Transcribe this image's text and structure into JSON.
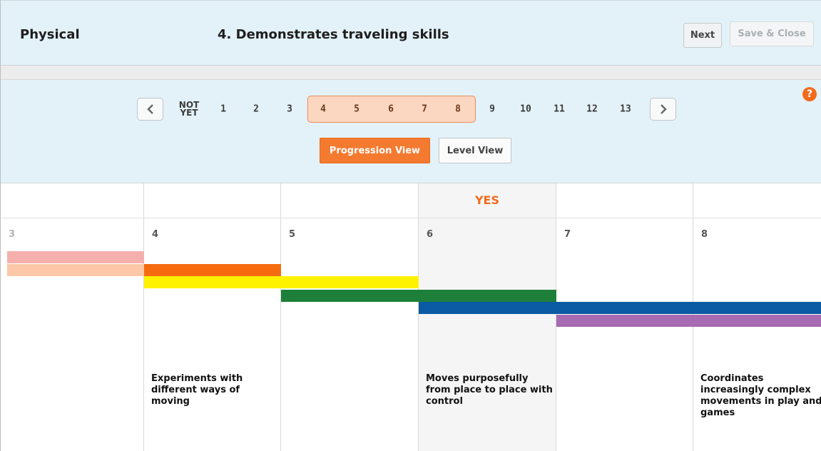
{
  "header": {
    "domain": "Physical",
    "item": "4. Demonstrates traveling skills",
    "next_label": "Next",
    "save_close_label": "Save & Close"
  },
  "levels": {
    "not_yet": "NOT\nYET",
    "items": [
      "1",
      "2",
      "3",
      "4",
      "5",
      "6",
      "7",
      "8",
      "9",
      "10",
      "11",
      "12",
      "13"
    ],
    "selected": [
      "4",
      "5",
      "6",
      "7",
      "8"
    ]
  },
  "views": {
    "progression": "Progression View",
    "level": "Level View",
    "active": "Progression View"
  },
  "help_icon": "help-icon",
  "progression": {
    "yes_label": "YES",
    "columns": [
      {
        "level": "3",
        "description": ""
      },
      {
        "level": "4",
        "description": "Experiments with different ways of moving"
      },
      {
        "level": "5",
        "description": ""
      },
      {
        "level": "6",
        "description": "Moves purposefully from place to place with control"
      },
      {
        "level": "7",
        "description": ""
      },
      {
        "level": "8",
        "description": "Coordinates increasingly complex movements in play and games"
      }
    ],
    "band_colors": {
      "pink": "#f5b0ae",
      "peach": "#fcc8a8",
      "orange": "#f66b10",
      "yellow": "#fff200",
      "green": "#1e7f3a",
      "blue": "#0b5aa4",
      "purple": "#a66bb0"
    }
  }
}
